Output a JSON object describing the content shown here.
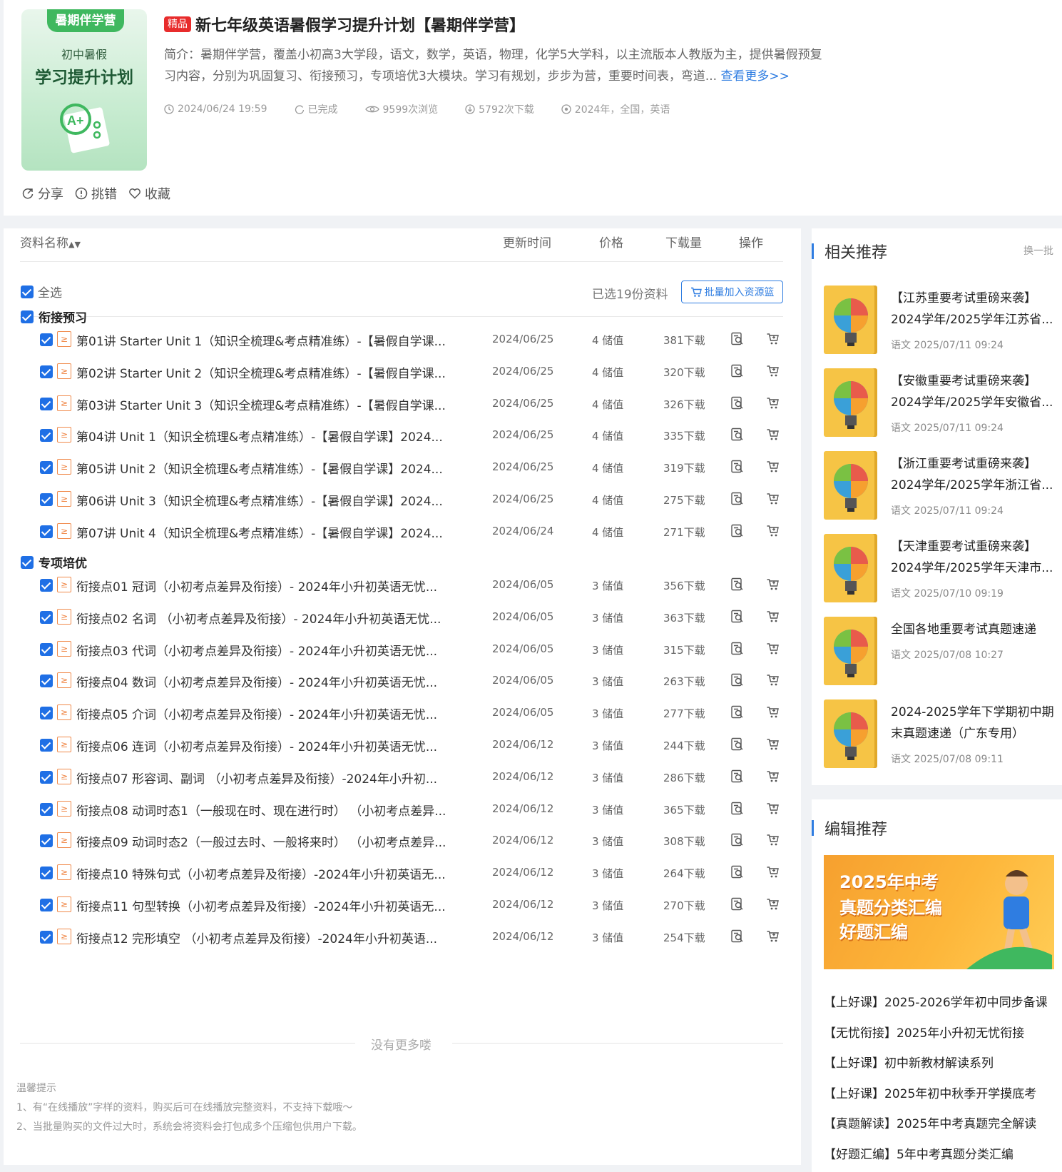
{
  "header": {
    "cover": {
      "tag": "暑期伴学营",
      "subtitle": "初中暑假",
      "title": "学习提升计划"
    },
    "badge": "精品",
    "title": "新七年级英语暑假学习提升计划【暑期伴学营】",
    "desc_line1": "简介：暑期伴学营，覆盖小初高3大学段，语文，数学，英语，物理，化学5大学科，以主流版本人教版为主，提供暑假预复",
    "desc_line2": "习内容，分别为巩固复习、衔接预习，专项培优3大模块。学习有规划，步步为营，重要时间表，弯道...",
    "more": "查看更多>>",
    "meta": {
      "time": "2024/06/24 19:59",
      "status": "已完成",
      "views": "9599次浏览",
      "downloads": "5792次下载",
      "tags": "2024年，全国，英语"
    },
    "actions": {
      "share": "分享",
      "report": "挑错",
      "fav": "收藏"
    }
  },
  "table": {
    "headers": {
      "name": "资料名称",
      "time": "更新时间",
      "price": "价格",
      "downloads": "下载量",
      "op": "操作"
    },
    "select_all": "全选",
    "selected_count": "已选19份资料",
    "batch_button": "批量加入资源篮",
    "sections": [
      {
        "title": "衔接预习",
        "rows": [
          {
            "name": "第01讲 Starter Unit 1（知识全梳理&考点精准练）-【暑假自学课...",
            "date": "2024/06/25",
            "price": "4 储值",
            "dl": "381下载"
          },
          {
            "name": "第02讲 Starter Unit 2（知识全梳理&考点精准练）-【暑假自学课...",
            "date": "2024/06/25",
            "price": "4 储值",
            "dl": "320下载"
          },
          {
            "name": "第03讲 Starter Unit 3（知识全梳理&考点精准练）-【暑假自学课...",
            "date": "2024/06/25",
            "price": "4 储值",
            "dl": "326下载"
          },
          {
            "name": "第04讲 Unit 1（知识全梳理&考点精准练）-【暑假自学课】2024...",
            "date": "2024/06/25",
            "price": "4 储值",
            "dl": "335下载"
          },
          {
            "name": "第05讲 Unit 2（知识全梳理&考点精准练）-【暑假自学课】2024...",
            "date": "2024/06/25",
            "price": "4 储值",
            "dl": "319下载"
          },
          {
            "name": "第06讲 Unit 3（知识全梳理&考点精准练）-【暑假自学课】2024...",
            "date": "2024/06/25",
            "price": "4 储值",
            "dl": "275下载"
          },
          {
            "name": "第07讲 Unit 4（知识全梳理&考点精准练）-【暑假自学课】2024...",
            "date": "2024/06/24",
            "price": "4 储值",
            "dl": "271下载"
          }
        ]
      },
      {
        "title": "专项培优",
        "rows": [
          {
            "name": "衔接点01 冠词（小初考点差异及衔接）- 2024年小升初英语无忧...",
            "date": "2024/06/05",
            "price": "3 储值",
            "dl": "356下载"
          },
          {
            "name": "衔接点02 名词 （小初考点差异及衔接）- 2024年小升初英语无忧...",
            "date": "2024/06/05",
            "price": "3 储值",
            "dl": "363下载"
          },
          {
            "name": "衔接点03 代词（小初考点差异及衔接）- 2024年小升初英语无忧...",
            "date": "2024/06/05",
            "price": "3 储值",
            "dl": "315下载"
          },
          {
            "name": "衔接点04 数词（小初考点差异及衔接）- 2024年小升初英语无忧...",
            "date": "2024/06/05",
            "price": "3 储值",
            "dl": "263下载"
          },
          {
            "name": "衔接点05 介词（小初考点差异及衔接）- 2024年小升初英语无忧...",
            "date": "2024/06/05",
            "price": "3 储值",
            "dl": "277下载"
          },
          {
            "name": "衔接点06 连词（小初考点差异及衔接）- 2024年小升初英语无忧...",
            "date": "2024/06/12",
            "price": "3 储值",
            "dl": "244下载"
          },
          {
            "name": "衔接点07 形容词、副词 （小初考点差异及衔接）-2024年小升初...",
            "date": "2024/06/12",
            "price": "3 储值",
            "dl": "286下载"
          },
          {
            "name": "衔接点08 动词时态1（一般现在时、现在进行时） （小初考点差异...",
            "date": "2024/06/12",
            "price": "3 储值",
            "dl": "365下载"
          },
          {
            "name": "衔接点09 动词时态2（一般过去时、一般将来时） （小初考点差异...",
            "date": "2024/06/12",
            "price": "3 储值",
            "dl": "308下载"
          },
          {
            "name": "衔接点10 特殊句式（小初考点差异及衔接）-2024年小升初英语无...",
            "date": "2024/06/12",
            "price": "3 储值",
            "dl": "264下载"
          },
          {
            "name": "衔接点11 句型转换（小初考点差异及衔接）-2024年小升初英语无...",
            "date": "2024/06/12",
            "price": "3 储值",
            "dl": "270下载"
          },
          {
            "name": "衔接点12 完形填空 （小初考点差异及衔接）-2024年小升初英语...",
            "date": "2024/06/12",
            "price": "3 储值",
            "dl": "254下载"
          }
        ]
      }
    ],
    "no_more": "没有更多喽",
    "tips": {
      "title": "温馨提示",
      "line1": "1、有“在线播放”字样的资料，购买后可在线播放完整资料，不支持下载哦～",
      "line2": "2、当批量购买的文件过大时，系统会将资料会打包成多个压缩包供用户下载。"
    }
  },
  "related": {
    "title": "相关推荐",
    "swap": "换一批",
    "items": [
      {
        "line1": "【江苏重要考试重磅来袭】",
        "line2": "2024学年/2025学年江苏省...",
        "meta": "语文 2025/07/11 09:24"
      },
      {
        "line1": "【安徽重要考试重磅来袭】",
        "line2": "2024学年/2025学年安徽省...",
        "meta": "语文 2025/07/11 09:24"
      },
      {
        "line1": "【浙江重要考试重磅来袭】",
        "line2": "2024学年/2025学年浙江省...",
        "meta": "语文 2025/07/11 09:24"
      },
      {
        "line1": "【天津重要考试重磅来袭】",
        "line2": "2024学年/2025学年天津市...",
        "meta": "语文 2025/07/10 09:19"
      },
      {
        "line1": "全国各地重要考试真题速递",
        "line2": "",
        "meta": "语文 2025/07/08 10:27"
      },
      {
        "line1": "2024-2025学年下学期初中期",
        "line2": "末真题速递（广东专用）",
        "meta": "语文 2025/07/08 09:11"
      }
    ]
  },
  "editor": {
    "title": "编辑推荐",
    "banner": {
      "l1": "2025年中考",
      "l2": "真题分类汇编",
      "l3": "好题汇编"
    },
    "links": [
      "【上好课】2025-2026学年初中同步备课",
      "【无忧衔接】2025年小升初无忧衔接",
      "【上好课】初中新教材解读系列",
      "【上好课】2025年初中秋季开学摸底考",
      "【真题解读】2025年中考真题完全解读",
      "【好题汇编】5年中考真题分类汇编"
    ]
  },
  "colors": {
    "accent": "#2f7de1",
    "checkbox": "#1f6fe5",
    "badge": "#e82c2c",
    "file_icon": "#f08a4b"
  }
}
